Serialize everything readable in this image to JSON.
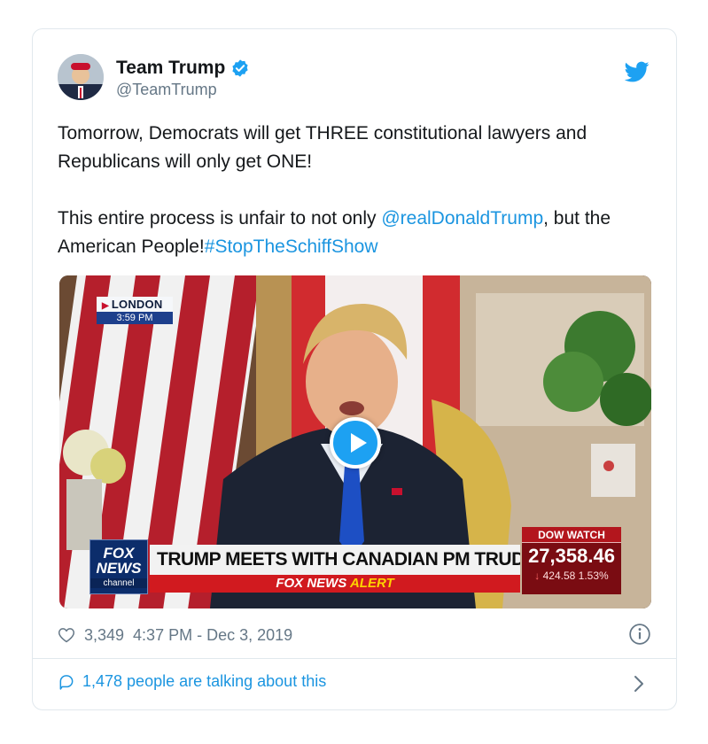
{
  "tweet": {
    "author_name": "Team Trump",
    "handle": "@TeamTrump",
    "text_line1_plain": "Tomorrow, Democrats will get THREE constitutional lawyers and Republicans will only get ONE!",
    "text_line2_prefix": "This entire process is unfair to not only ",
    "mention": "@realDonaldTrump",
    "text_line2_mid": ", but the American People!",
    "hashtag": "#StopTheSchiffShow",
    "likes": "3,349",
    "timestamp": "4:37 PM - Dec 3, 2019",
    "talking": "1,478 people are talking about this"
  },
  "video": {
    "location": "LONDON",
    "time": "3:59 PM",
    "network_line1": "FOX",
    "network_line2": "NEWS",
    "network_line3": "channel",
    "headline": "TRUMP MEETS WITH CANADIAN PM TRUDEAU",
    "alert_prefix": "FOX NEWS",
    "alert_suffix": "ALERT",
    "dow_label": "DOW WATCH",
    "dow_value": "27,358.46",
    "dow_change": "424.58",
    "dow_percent": "1.53%"
  },
  "colors": {
    "link": "#1b95e0",
    "verified": "#1da1f2",
    "text_secondary": "#657786"
  },
  "icons": [
    "verified-badge-icon",
    "twitter-bird-icon",
    "heart-icon",
    "info-icon",
    "speech-bubble-icon",
    "chevron-right-icon",
    "play-icon"
  ]
}
